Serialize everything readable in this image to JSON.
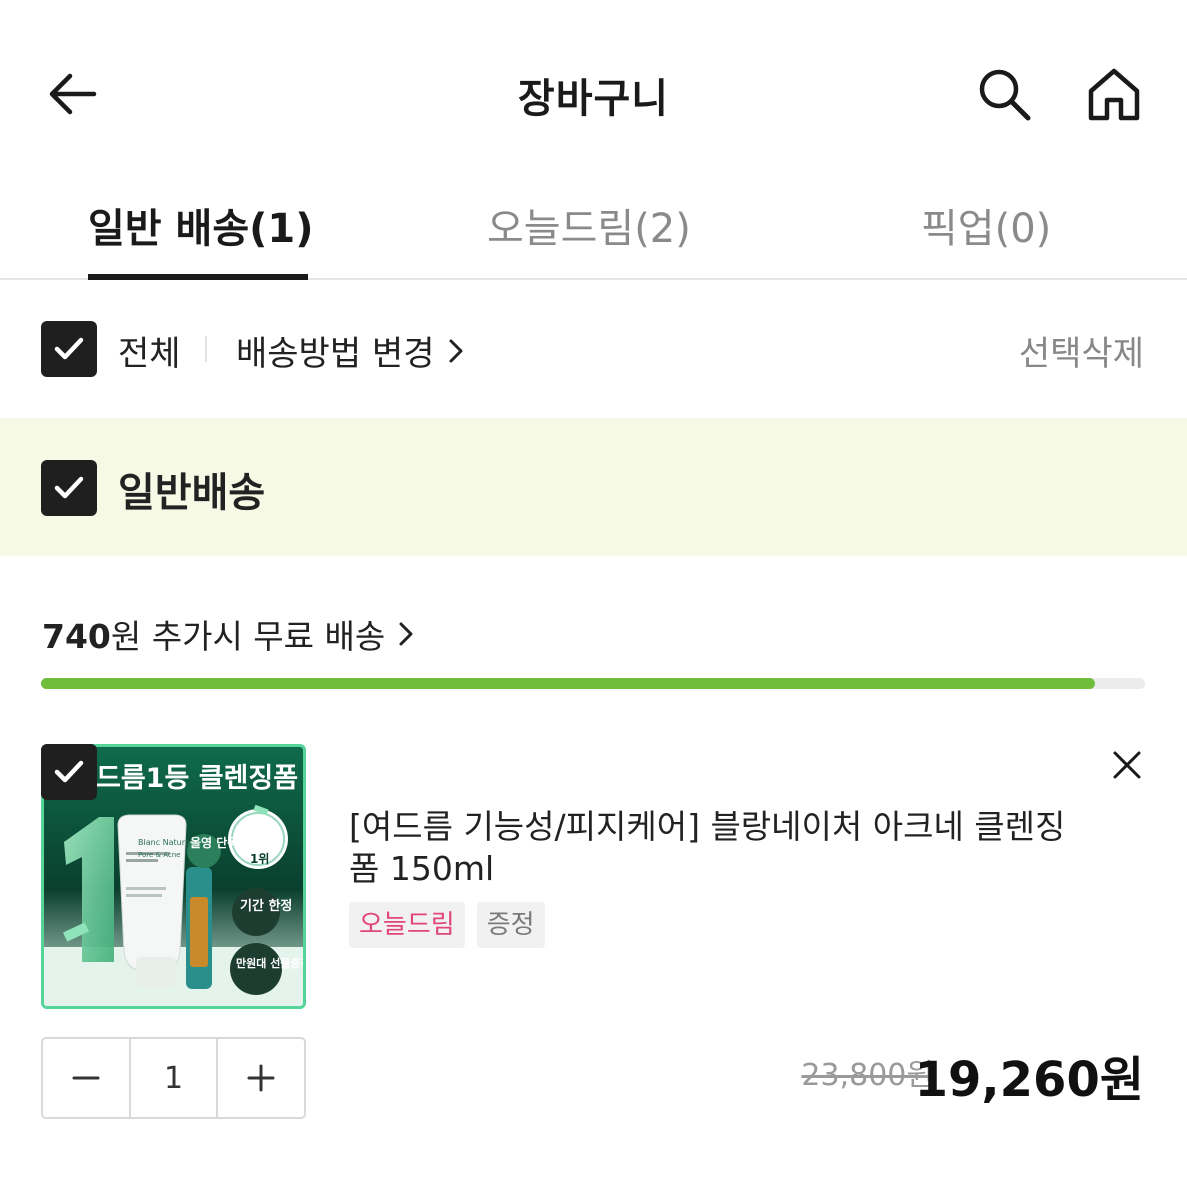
{
  "header": {
    "title": "장바구니",
    "back_icon": "arrow-left-icon",
    "search_icon": "search-icon",
    "home_icon": "home-icon"
  },
  "tabs": [
    {
      "label": "일반 배송(1)",
      "active": true
    },
    {
      "label": "오늘드림(2)",
      "active": false
    },
    {
      "label": "픽업(0)",
      "active": false
    }
  ],
  "select_bar": {
    "all_label": "전체",
    "all_checked": true,
    "change_shipping_label": "배송방법 변경",
    "delete_selected_label": "선택삭제"
  },
  "group": {
    "label": "일반배송",
    "checked": true
  },
  "free_shipping": {
    "amount": "740",
    "text": "원 추가시 무료 배송",
    "progress": 0.955,
    "progress_color": "#6fbd3b"
  },
  "product": {
    "checked": true,
    "name": "[여드름 기능성/피지케어] 블랑네이처 아크네 클렌징폼 150ml",
    "badges": [
      "오늘드림",
      "증정"
    ],
    "quantity": "1",
    "original_price": "23,800원",
    "sale_price": "19,260원",
    "image": {
      "headline": "드름1등 클렌징폼",
      "brand": "Blanc Nature",
      "line": "Pore & Acne",
      "award": "1위",
      "tag_exclusive": "올영 단독",
      "tag_limited": "기간 한정",
      "tag_gift": "만원대 선물증정"
    }
  },
  "colors": {
    "accent_green": "#6fbd3b",
    "band_bg": "#f6f9e6",
    "badge_pink": "#e0457b"
  }
}
